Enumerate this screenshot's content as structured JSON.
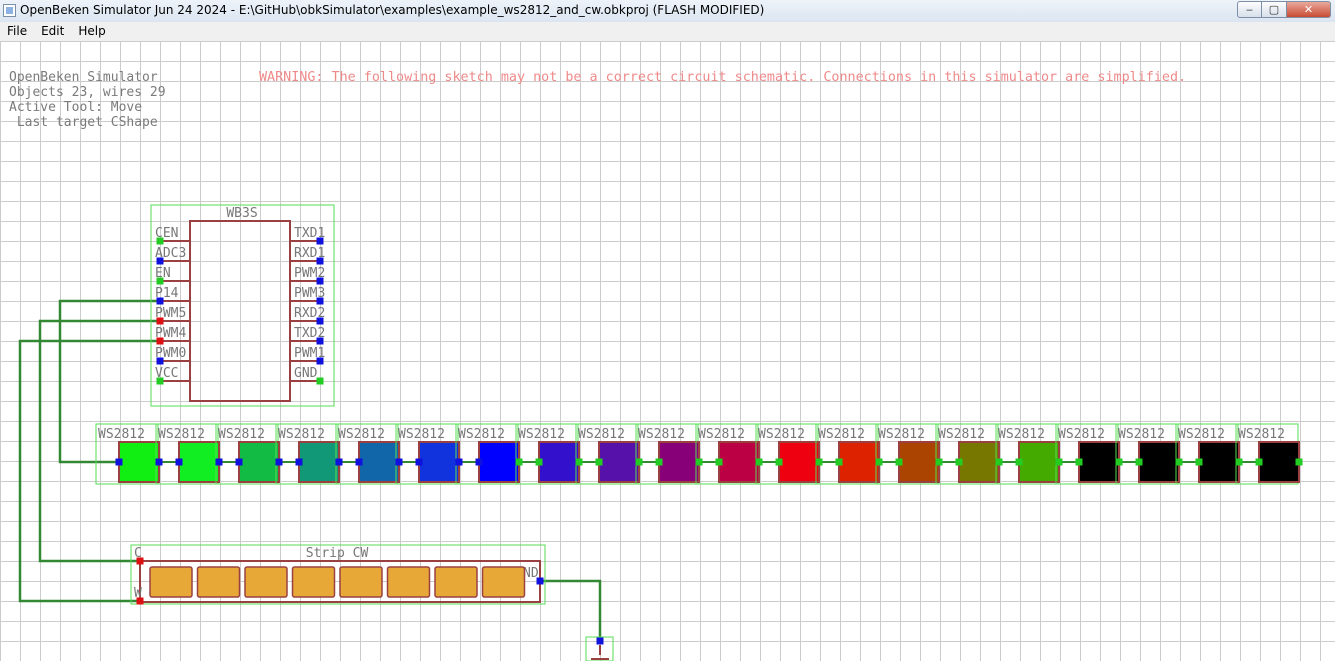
{
  "window": {
    "title": "OpenBeken Simulator Jun 24 2024 - E:\\GitHub\\obkSimulator\\examples\\example_ws2812_and_cw.obkproj (FLASH MODIFIED)",
    "min_glyph": "‒",
    "max_glyph": "▢",
    "close_glyph": "✕"
  },
  "menu": [
    "File",
    "Edit",
    "Help"
  ],
  "info": {
    "line1": "OpenBeken Simulator",
    "line2": "Objects 23, wires 29",
    "line3": "Active Tool: Move",
    "line4": " Last target CShape"
  },
  "warning": "WARNING: The following sketch may not be a correct circuit schematic. Connections in this simulator are simplified.",
  "wb3s": {
    "label": "WB3S",
    "left_pins": [
      {
        "name": "CEN",
        "color": "#22cc22"
      },
      {
        "name": "ADC3",
        "color": "#1111dd"
      },
      {
        "name": "EN",
        "color": "#22cc22"
      },
      {
        "name": "P14",
        "color": "#1111dd"
      },
      {
        "name": "PWM5",
        "color": "#dd1111"
      },
      {
        "name": "PWM4",
        "color": "#dd1111"
      },
      {
        "name": "PWM0",
        "color": "#1111dd"
      },
      {
        "name": "VCC",
        "color": "#22cc22"
      }
    ],
    "right_pins": [
      {
        "name": "TXD1",
        "color": "#1111dd"
      },
      {
        "name": "RXD1",
        "color": "#1111dd"
      },
      {
        "name": "PWM2",
        "color": "#1111dd"
      },
      {
        "name": "PWM3",
        "color": "#1111dd"
      },
      {
        "name": "RXD2",
        "color": "#1111dd"
      },
      {
        "name": "TXD2",
        "color": "#1111dd"
      },
      {
        "name": "PWM1",
        "color": "#1111dd"
      },
      {
        "name": "GND",
        "color": "#22cc22"
      }
    ]
  },
  "ws2812": {
    "label": "WS2812",
    "leds": [
      {
        "color": "#11ee11",
        "in": "#1111dd",
        "out": "#1111dd"
      },
      {
        "color": "#11ee22",
        "in": "#1111dd",
        "out": "#1111dd"
      },
      {
        "color": "#11bb44",
        "in": "#1111dd",
        "out": "#1111dd"
      },
      {
        "color": "#119977",
        "in": "#1111dd",
        "out": "#1111dd"
      },
      {
        "color": "#1166aa",
        "in": "#1111dd",
        "out": "#1111dd"
      },
      {
        "color": "#1133dd",
        "in": "#1111dd",
        "out": "#1111dd"
      },
      {
        "color": "#0000ff",
        "in": "#1111dd",
        "out": "#22cc22"
      },
      {
        "color": "#3311cc",
        "in": "#22cc22",
        "out": "#22cc22"
      },
      {
        "color": "#5511aa",
        "in": "#22cc22",
        "out": "#22cc22"
      },
      {
        "color": "#880077",
        "in": "#22cc22",
        "out": "#22cc22"
      },
      {
        "color": "#bb0044",
        "in": "#22cc22",
        "out": "#22cc22"
      },
      {
        "color": "#ee0011",
        "in": "#22cc22",
        "out": "#22cc22"
      },
      {
        "color": "#dd2200",
        "in": "#22cc22",
        "out": "#22cc22"
      },
      {
        "color": "#aa4400",
        "in": "#22cc22",
        "out": "#22cc22"
      },
      {
        "color": "#777700",
        "in": "#22cc22",
        "out": "#22cc22"
      },
      {
        "color": "#44aa00",
        "in": "#22cc22",
        "out": "#22cc22"
      },
      {
        "color": "#000000",
        "in": "#22cc22",
        "out": "#22cc22"
      },
      {
        "color": "#000000",
        "in": "#22cc22",
        "out": "#22cc22"
      },
      {
        "color": "#000000",
        "in": "#22cc22",
        "out": "#22cc22"
      },
      {
        "color": "#000000",
        "in": "#22cc22",
        "out": "#22cc22"
      }
    ]
  },
  "strip": {
    "label": "Strip CW",
    "pin_c": "C",
    "pin_w": "W",
    "pin_gnd": "ND",
    "segment_count": 8,
    "segment_color": "#e8a838"
  },
  "colors": {
    "outline": "#9a4040",
    "selection": "#55dd55",
    "wire": "#338833",
    "grid": "#cccccc",
    "pin_text": "#777777"
  }
}
